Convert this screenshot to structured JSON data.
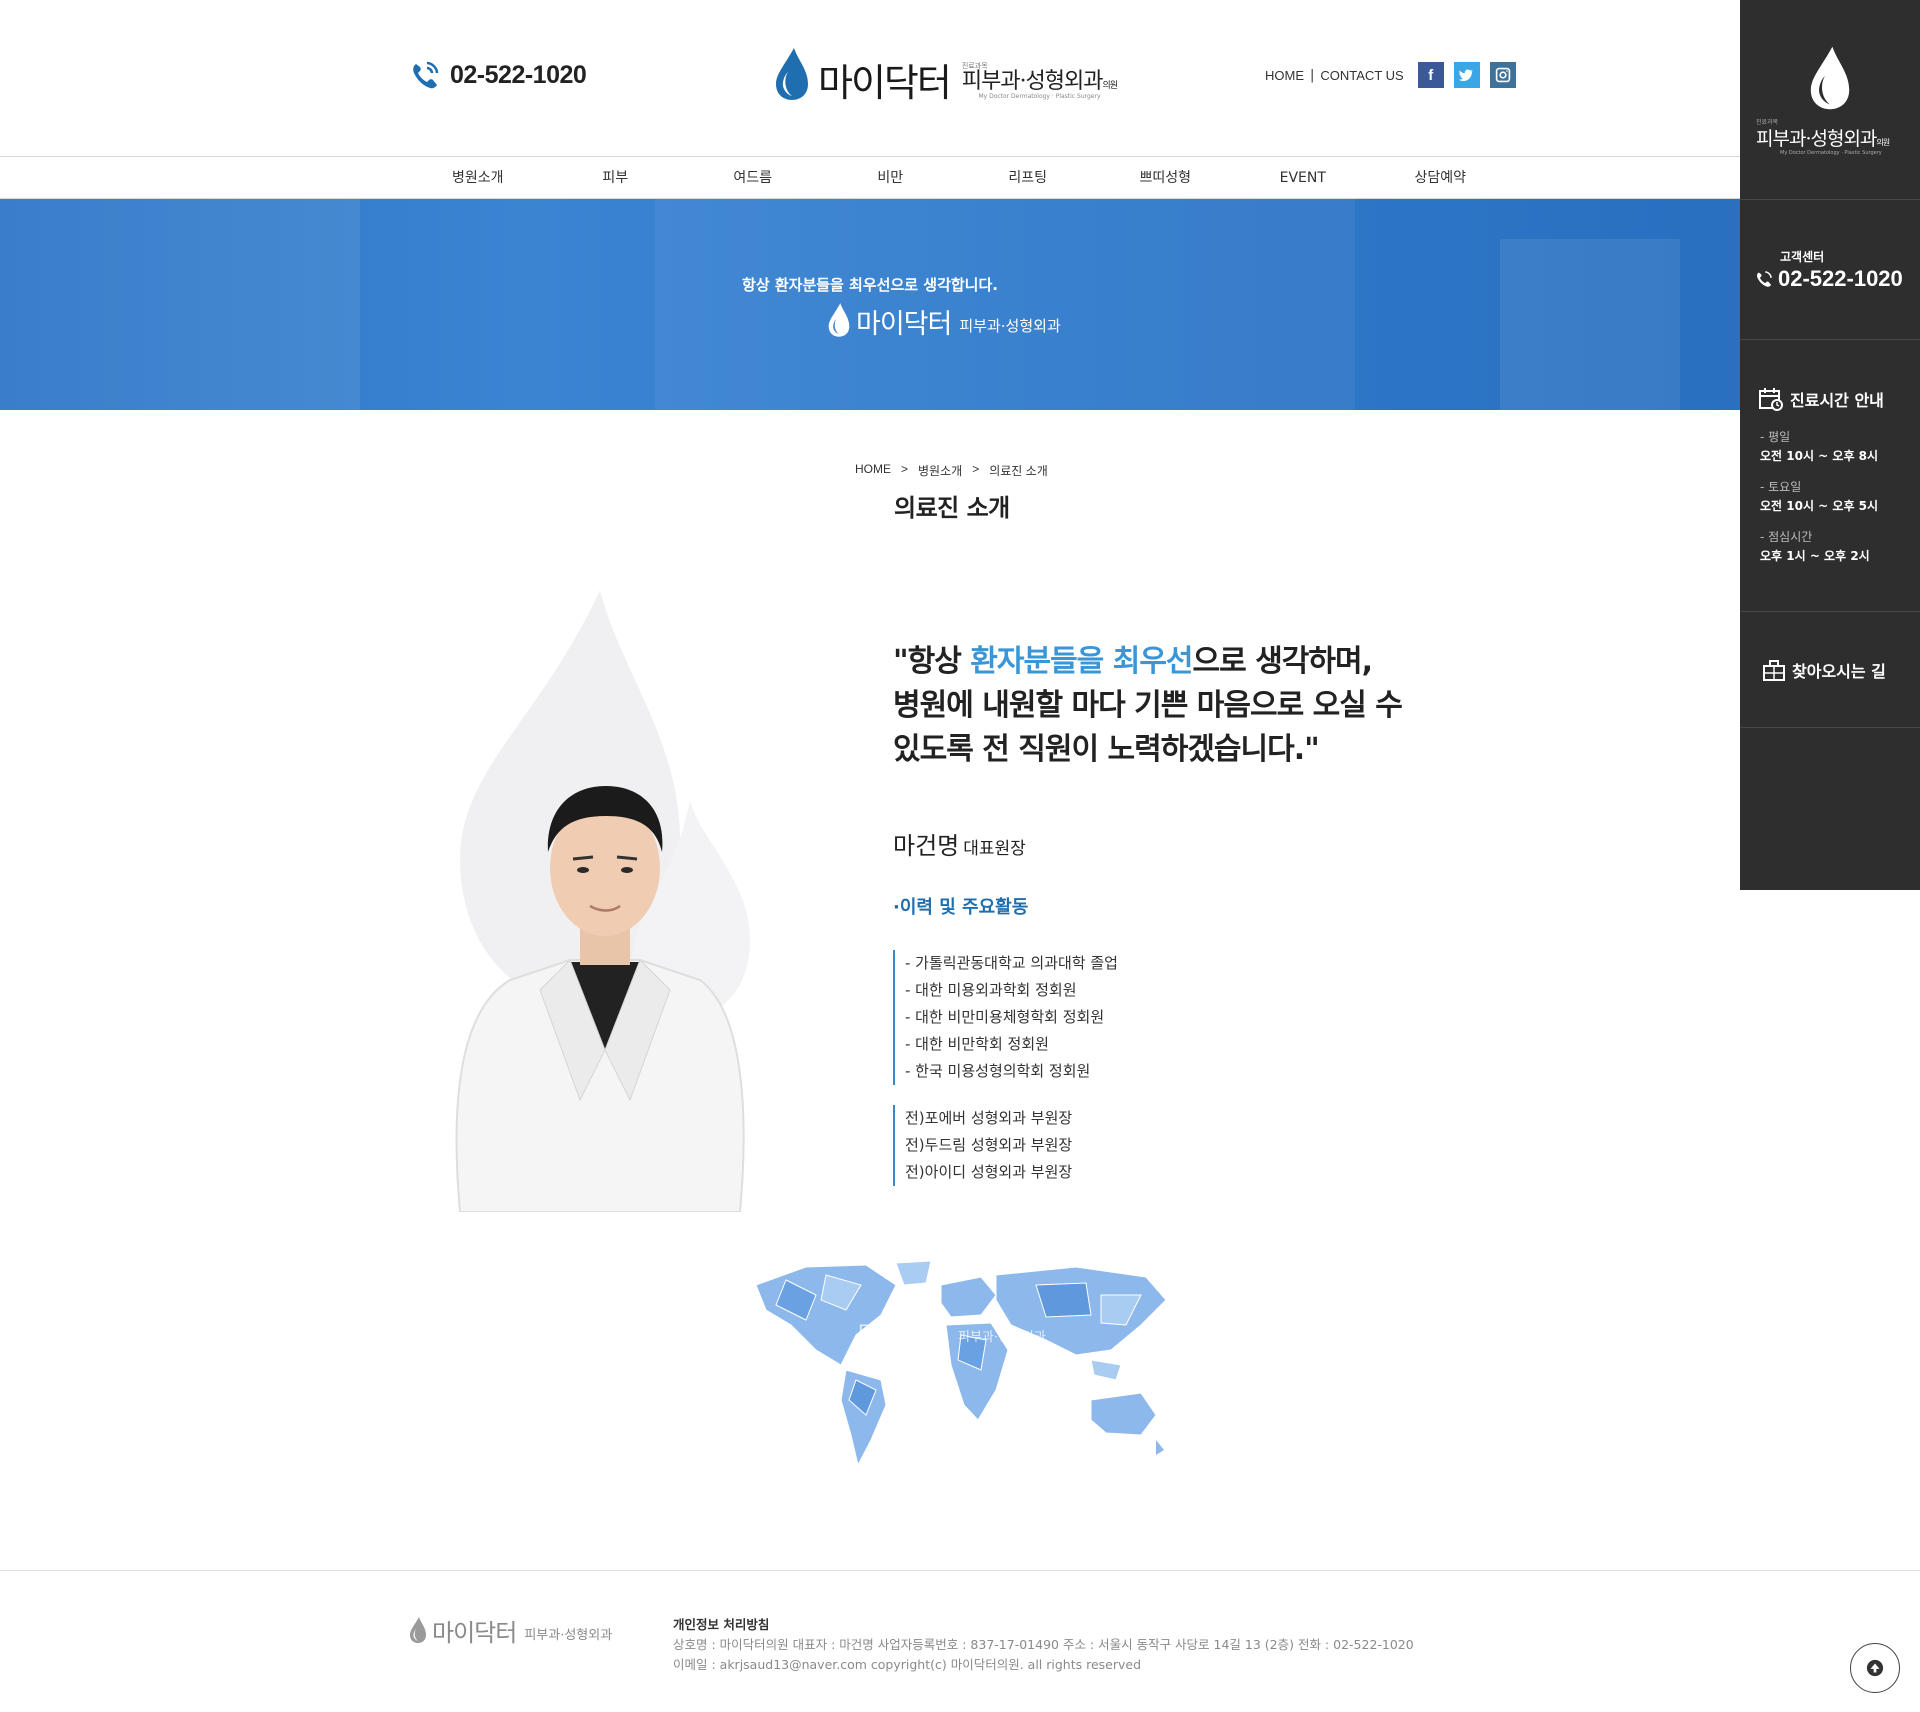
{
  "header": {
    "phone": "02-522-1020",
    "logo": {
      "main": "마이닥터",
      "tiny": "진료과목",
      "sub": "피부과·성형외과",
      "sub_suffix": "의원",
      "en": "My Doctor Dermatology · Plastic Surgery"
    },
    "links": {
      "home": "HOME",
      "sep": "|",
      "contact": "CONTACT US"
    },
    "social": [
      {
        "name": "facebook",
        "glyph": "f",
        "color": "#3b5998"
      },
      {
        "name": "twitter",
        "glyph": "t",
        "color": "#3aa7e4"
      },
      {
        "name": "instagram",
        "glyph": "◎",
        "color": "#3f729b"
      }
    ]
  },
  "nav": [
    "병원소개",
    "피부",
    "여드름",
    "비만",
    "리프팅",
    "쁘띠성형",
    "EVENT",
    "상담예약"
  ],
  "banner": {
    "tagline": "항상 환자분들을 최우선으로 생각합니다.",
    "logo_main": "마이닥터",
    "logo_sub": "피부과·성형외과"
  },
  "breadcrumb": {
    "home": "HOME",
    "sep": ">",
    "level1": "병원소개",
    "level2": "의료진 소개"
  },
  "page_title": "의료진 소개",
  "quote": {
    "open": "\"항상 ",
    "highlight1": "환자분들을",
    "space": " ",
    "highlight2": "최우선",
    "rest1": "으로 생각하며,",
    "line2": "병원에 내원할 마다 기쁜 마음으로 오실 수",
    "line3": "있도록 전 직원이 노력하겠습니다.\""
  },
  "doctor": {
    "name": "마건명",
    "role": "대표원장",
    "career_title": "·이력 및 주요활동",
    "career": [
      "- 가톨릭관동대학교 의과대학 졸업",
      "- 대한 미용외과학회 정회원",
      "- 대한 비만미용체형학회 정회원",
      "- 대한 비만학회 정회원",
      "- 한국 미용성형의학회 정회원"
    ],
    "former": [
      "전)포에버 성형외과 부원장",
      "전)두드림 성형외과 부원장",
      "전)아이디 성형외과 부원장"
    ]
  },
  "worldmap": {
    "logo_main": "마이닥터",
    "logo_sub": "피부과·성형외과"
  },
  "footer": {
    "logo_main": "마이닥터",
    "logo_sub": "피부과·성형외과",
    "policy": "개인정보 처리방침",
    "line1": "상호명 : 마이닥터의원 대표자 : 마건명 사업자등록번호 : 837-17-01490 주소 : 서울시 동작구 사당로 14길 13 (2층) 전화 : 02-522-1020",
    "line2": "이메일 : akrjsaud13@naver.com copyright(c) 마이닥터의원. all rights reserved"
  },
  "quickbar": {
    "logo_tiny": "진료과목",
    "logo_sub": "피부과·성형외과",
    "logo_suffix": "의원",
    "logo_en": "My Doctor Dermatology · Plastic Surgery",
    "cs_label": "고객센터",
    "cs_phone": "02-522-1020",
    "hours_title": "진료시간 안내",
    "hours": [
      {
        "label": "- 평일",
        "value": "오전 10시 ~ 오후 8시"
      },
      {
        "label": "- 토요일",
        "value": "오전 10시 ~ 오후 5시"
      },
      {
        "label": "- 점심시간",
        "value": "오후 1시 ~ 오후 2시"
      }
    ],
    "directions": "찾아오시는 길"
  },
  "colors": {
    "accent": "#3a96d6",
    "brand_blue": "#1f6fb0",
    "banner": "#2f7bcc",
    "quickbar_bg": "#2e2e2e"
  }
}
